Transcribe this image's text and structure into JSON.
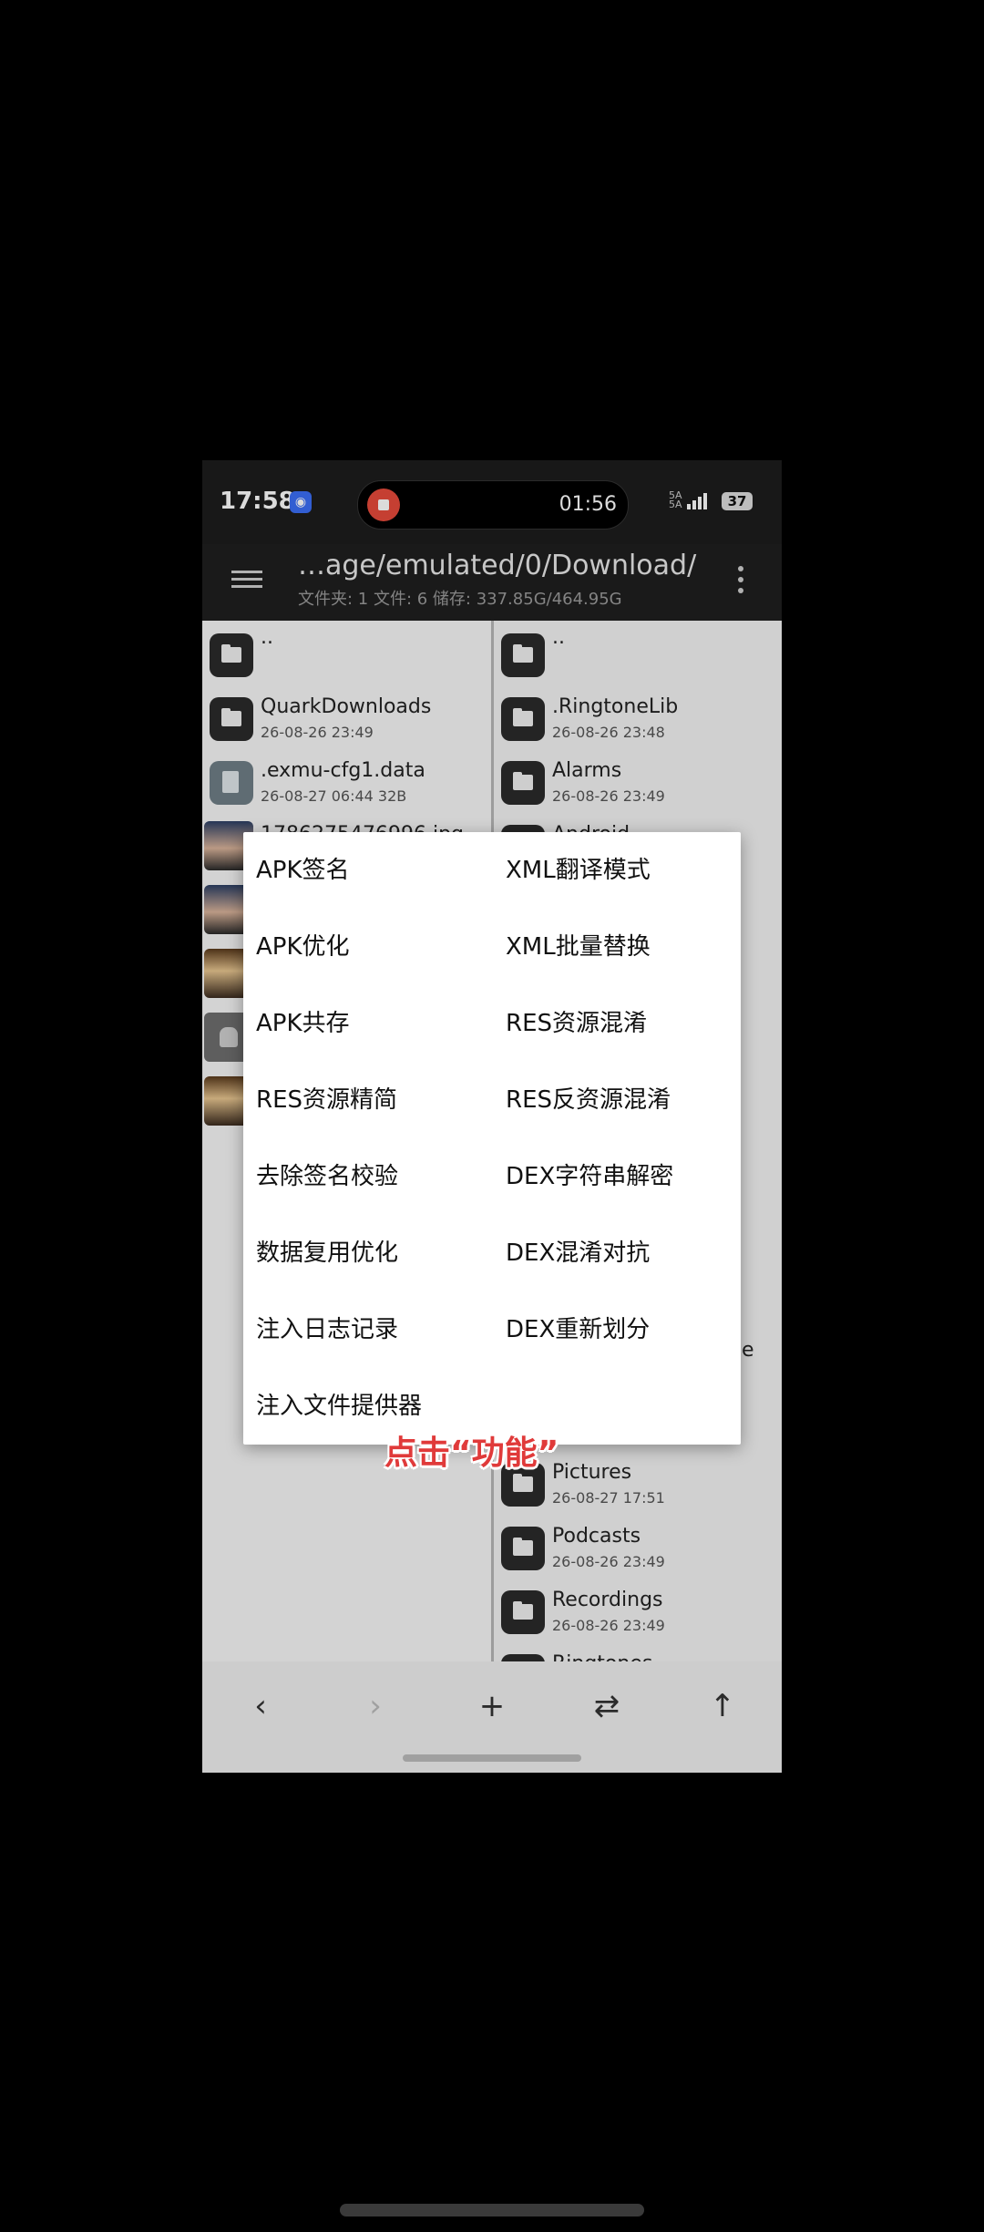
{
  "status_bar": {
    "time": "17:58",
    "record_timer": "01:56",
    "network": "5A 5A",
    "battery": "37"
  },
  "app_bar": {
    "path": "…age/emulated/0/Download/",
    "summary": "文件夹: 1  文件: 6  储存: 337.85G/464.95G"
  },
  "left_pane": {
    "items": [
      {
        "name": "..",
        "meta": "",
        "icon": "folder-icon"
      },
      {
        "name": "QuarkDownloads",
        "meta": "26-08-26 23:49",
        "icon": "folder-icon"
      },
      {
        "name": ".exmu-cfg1.data",
        "meta": "26-08-27 06:44  32B",
        "icon": "file-icon"
      },
      {
        "name": "1786275476996.jpg",
        "meta": "",
        "icon": "photo-thumbnail"
      },
      {
        "name": "",
        "meta": "",
        "icon": "photo-thumbnail"
      },
      {
        "name": "",
        "meta": "",
        "icon": "photo-thumbnail"
      },
      {
        "name": "",
        "meta": "",
        "icon": "android-icon"
      },
      {
        "name": "",
        "meta": "",
        "icon": "photo-thumbnail"
      }
    ]
  },
  "right_pane": {
    "items": [
      {
        "name": "..",
        "meta": ""
      },
      {
        "name": ".RingtoneLib",
        "meta": "26-08-26 23:48"
      },
      {
        "name": "Alarms",
        "meta": "26-08-26 23:49"
      },
      {
        "name": "Android",
        "meta": ""
      },
      {
        "name": "Pictures",
        "meta": "26-08-27 17:51"
      },
      {
        "name": "Podcasts",
        "meta": "26-08-26 23:49"
      },
      {
        "name": "Recordings",
        "meta": "26-08-26 23:49"
      },
      {
        "name": "Ringtones",
        "meta": ""
      }
    ],
    "partial_text": "e"
  },
  "popup_menu": {
    "left_column": [
      "APK签名",
      "APK优化",
      "APK共存",
      "RES资源精简",
      "去除签名校验",
      "数据复用优化",
      "注入日志记录",
      "注入文件提供器"
    ],
    "right_column": [
      "XML翻译模式",
      "XML批量替换",
      "RES资源混淆",
      "RES反资源混淆",
      "DEX字符串解密",
      "DEX混淆对抗",
      "DEX重新划分"
    ]
  },
  "caption": "点击“功能”",
  "bottom_nav": {
    "back": "‹",
    "forward": "›",
    "add": "+",
    "swap": "⇄",
    "up": "↑"
  },
  "colors": {
    "accent_record": "#e64a3b",
    "caption": "#e03a3a",
    "app_bar": "#1f1f1f"
  }
}
